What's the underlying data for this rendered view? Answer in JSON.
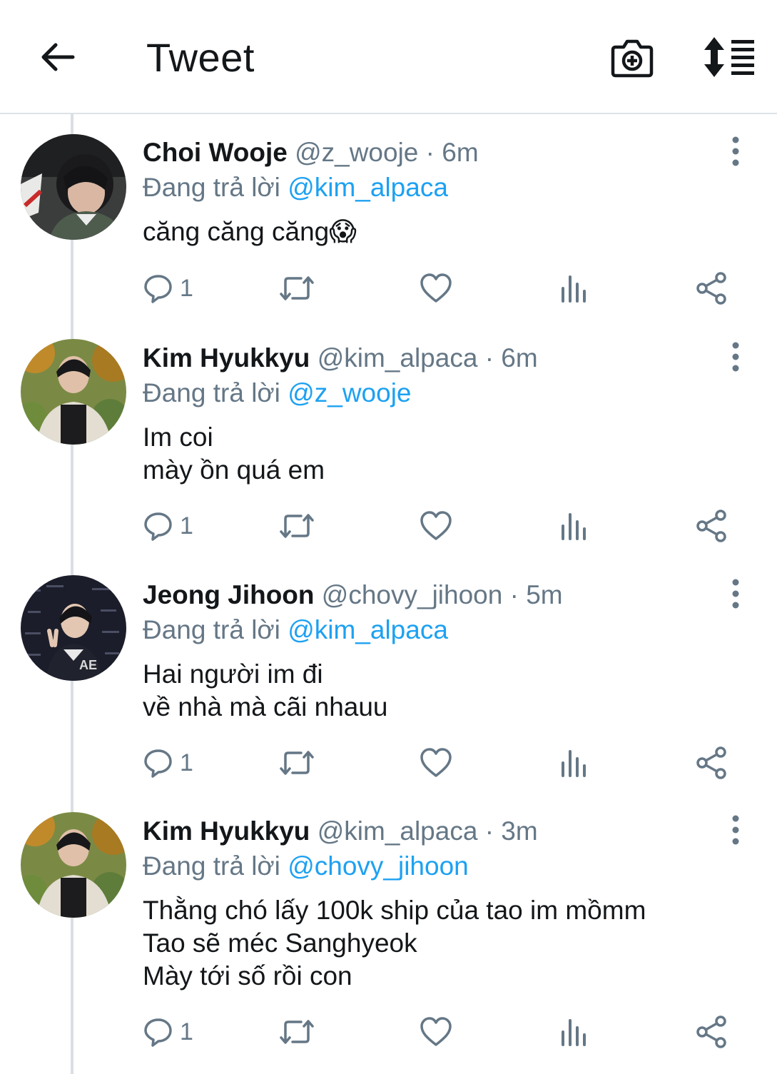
{
  "header": {
    "title": "Tweet",
    "back_icon": "arrow-left-icon",
    "camera_icon": "camera-plus-icon",
    "sort_icon": "sort-list-icon"
  },
  "colors": {
    "link": "#1da1f2",
    "muted": "#657786",
    "text": "#14171a",
    "divider": "#d9dfe3"
  },
  "tweets": [
    {
      "name": "Choi Wooje",
      "handle": "@z_wooje",
      "time": "· 6m",
      "reply_prefix": "Đang trả lời",
      "reply_to": "@kim_alpaca",
      "text": "căng căng căng😱",
      "reply_count": "1"
    },
    {
      "name": "Kim Hyukkyu",
      "handle": "@kim_alpaca",
      "time": "· 6m",
      "reply_prefix": "Đang trả lời",
      "reply_to": "@z_wooje",
      "text": "Im coi\nmày ồn quá em",
      "reply_count": "1"
    },
    {
      "name": "Jeong Jihoon",
      "handle": "@chovy_jihoon",
      "time": "· 5m",
      "reply_prefix": "Đang trả lời",
      "reply_to": "@kim_alpaca",
      "text": "Hai người im đi\nvề nhà mà cãi nhauu",
      "reply_count": "1"
    },
    {
      "name": "Kim Hyukkyu",
      "handle": "@kim_alpaca",
      "time": "· 3m",
      "reply_prefix": "Đang trả lời",
      "reply_to": "@chovy_jihoon",
      "text": "Thằng chó lấy 100k ship của tao im mồmm\nTao sẽ méc Sanghyeok\nMày tới số rồi con",
      "reply_count": "1"
    }
  ],
  "action_icons": [
    "reply-icon",
    "retweet-icon",
    "like-icon",
    "analytics-icon",
    "share-icon"
  ]
}
